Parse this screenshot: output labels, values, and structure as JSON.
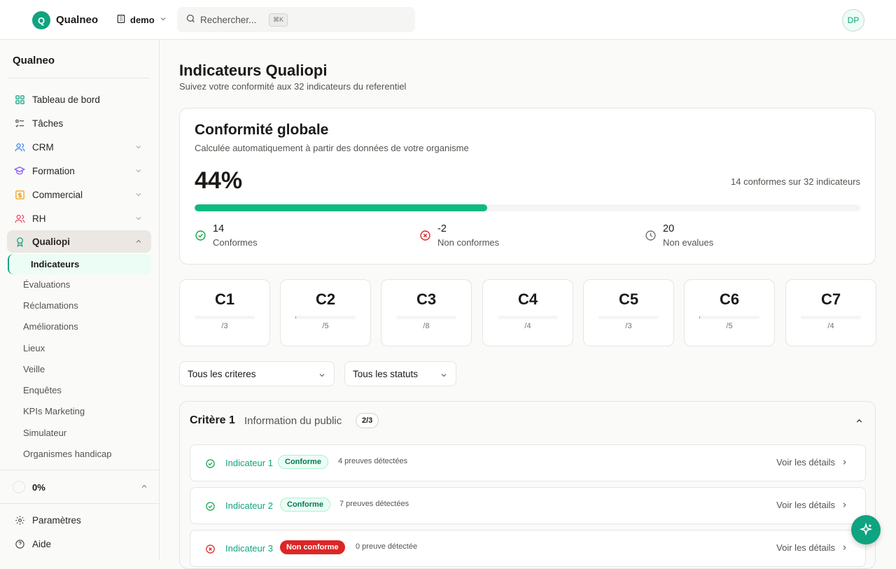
{
  "topbar": {
    "logo_letter": "Q",
    "app_name": "Qualneo",
    "workspace": "demo",
    "search_placeholder": "Rechercher...",
    "shortcut": "⌘K",
    "avatar_initials": "DP"
  },
  "sidebar": {
    "brand": "Qualneo",
    "items": [
      {
        "label": "Tableau de bord",
        "icon": "dashboard-icon"
      },
      {
        "label": "Tâches",
        "icon": "tasks-icon"
      },
      {
        "label": "CRM",
        "icon": "users-icon"
      },
      {
        "label": "Formation",
        "icon": "graduation-cap-icon"
      },
      {
        "label": "Commercial",
        "icon": "commercial-icon"
      },
      {
        "label": "RH",
        "icon": "people-icon"
      },
      {
        "label": "Qualiopi",
        "icon": "award-icon"
      }
    ],
    "subitems": [
      "Indicateurs",
      "Évaluations",
      "Réclamations",
      "Améliorations",
      "Lieux",
      "Veille",
      "Enquêtes",
      "KPIs Marketing",
      "Simulateur",
      "Organismes handicap"
    ],
    "progress": "0%",
    "footer": [
      {
        "label": "Paramètres",
        "icon": "gear-icon"
      },
      {
        "label": "Aide",
        "icon": "help-icon"
      }
    ]
  },
  "page": {
    "title": "Indicateurs Qualiopi",
    "subtitle": "Suivez votre conformité aux 32 indicateurs du referentiel"
  },
  "global": {
    "title": "Conformité globale",
    "subtitle": "Calculée automatiquement à partir des données de votre organisme",
    "percent": "44%",
    "percent_value": 44,
    "count_text": "14 conformes sur 32 indicateurs",
    "stats": [
      {
        "value": "14",
        "label": "Conformes",
        "color": "#16a34a"
      },
      {
        "value": "-2",
        "label": "Non conformes",
        "color": "#dc2626"
      },
      {
        "value": "20",
        "label": "Non evalues",
        "color": "#78716c"
      }
    ]
  },
  "criteria": [
    {
      "code": "C1",
      "detail": "/3",
      "fill": 0
    },
    {
      "code": "C2",
      "detail": "/5",
      "fill": 0.01
    },
    {
      "code": "C3",
      "detail": "/8",
      "fill": 0
    },
    {
      "code": "C4",
      "detail": "/4",
      "fill": 0
    },
    {
      "code": "C5",
      "detail": "/3",
      "fill": 0
    },
    {
      "code": "C6",
      "detail": "/5",
      "fill": 0.01
    },
    {
      "code": "C7",
      "detail": "/4",
      "fill": 0
    }
  ],
  "filters": {
    "criteria": "Tous les criteres",
    "status": "Tous les statuts"
  },
  "section": {
    "title": "Critère 1",
    "name": "Information du public",
    "badge": "2/3",
    "indicators": [
      {
        "name": "Indicateur 1",
        "status": "Conforme",
        "ok": true,
        "proofs": "4 preuves détectées",
        "details": "Voir les détails"
      },
      {
        "name": "Indicateur 2",
        "status": "Conforme",
        "ok": true,
        "proofs": "7 preuves détectées",
        "details": "Voir les détails"
      },
      {
        "name": "Indicateur 3",
        "status": "Non conforme",
        "ok": false,
        "proofs": "0 preuve détectée",
        "details": "Voir les détails"
      }
    ]
  },
  "colors": {
    "accent": "#10a37f",
    "success": "#10b981",
    "danger": "#dc2626"
  }
}
